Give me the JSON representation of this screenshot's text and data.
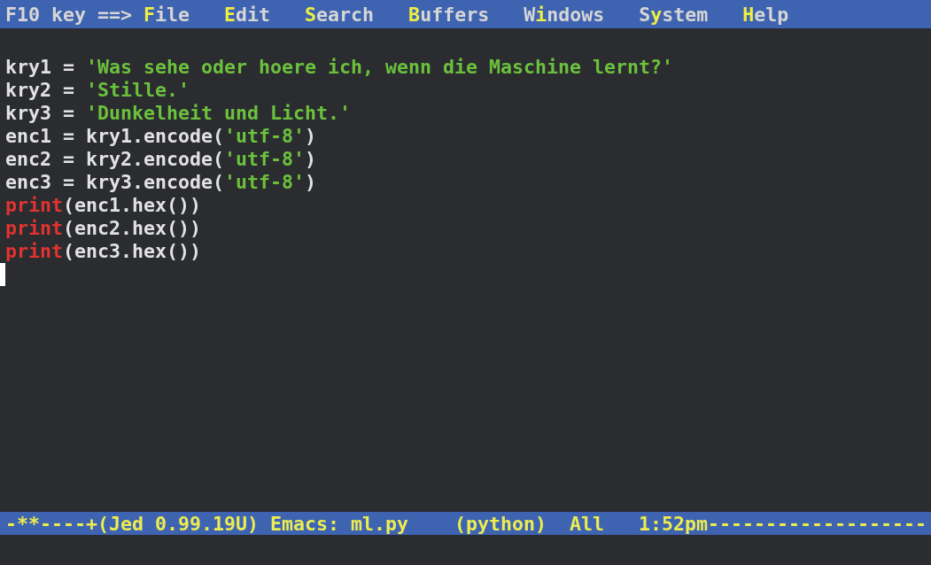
{
  "menu_bar": {
    "prefix": "F10 key ==> ",
    "items": [
      {
        "hotkey": "F",
        "after": "ile"
      },
      {
        "hotkey": "E",
        "after": "dit"
      },
      {
        "hotkey": "S",
        "after": "earch"
      },
      {
        "hotkey": "B",
        "after": "uffers"
      },
      {
        "before": "W",
        "hotkey": "i",
        "after": "ndows"
      },
      {
        "before": "S",
        "hotkey": "y",
        "after": "stem"
      },
      {
        "hotkey": "H",
        "after": "elp"
      }
    ]
  },
  "editor": {
    "lines": [
      [
        {
          "kind": "plain",
          "text": "kry1 = "
        },
        {
          "kind": "string",
          "text": "'Was sehe oder hoere ich, wenn die Maschine lernt?'"
        }
      ],
      [
        {
          "kind": "plain",
          "text": "kry2 = "
        },
        {
          "kind": "string",
          "text": "'Stille.'"
        }
      ],
      [
        {
          "kind": "plain",
          "text": "kry3 = "
        },
        {
          "kind": "string",
          "text": "'Dunkelheit und Licht.'"
        }
      ],
      [
        {
          "kind": "plain",
          "text": "enc1 = kry1.encode("
        },
        {
          "kind": "string",
          "text": "'utf-8'"
        },
        {
          "kind": "plain",
          "text": ")"
        }
      ],
      [
        {
          "kind": "plain",
          "text": "enc2 = kry2.encode("
        },
        {
          "kind": "string",
          "text": "'utf-8'"
        },
        {
          "kind": "plain",
          "text": ")"
        }
      ],
      [
        {
          "kind": "plain",
          "text": "enc3 = kry3.encode("
        },
        {
          "kind": "string",
          "text": "'utf-8'"
        },
        {
          "kind": "plain",
          "text": ")"
        }
      ],
      [
        {
          "kind": "builtin",
          "text": "print"
        },
        {
          "kind": "plain",
          "text": "(enc1.hex())"
        }
      ],
      [
        {
          "kind": "builtin",
          "text": "print"
        },
        {
          "kind": "plain",
          "text": "(enc2.hex())"
        }
      ],
      [
        {
          "kind": "builtin",
          "text": "print"
        },
        {
          "kind": "plain",
          "text": "(enc3.hex())"
        }
      ]
    ]
  },
  "status_bar": {
    "text": "-**----+(Jed 0.99.19U) Emacs: ml.py    (python)  All   1:52pm-------------------"
  }
}
